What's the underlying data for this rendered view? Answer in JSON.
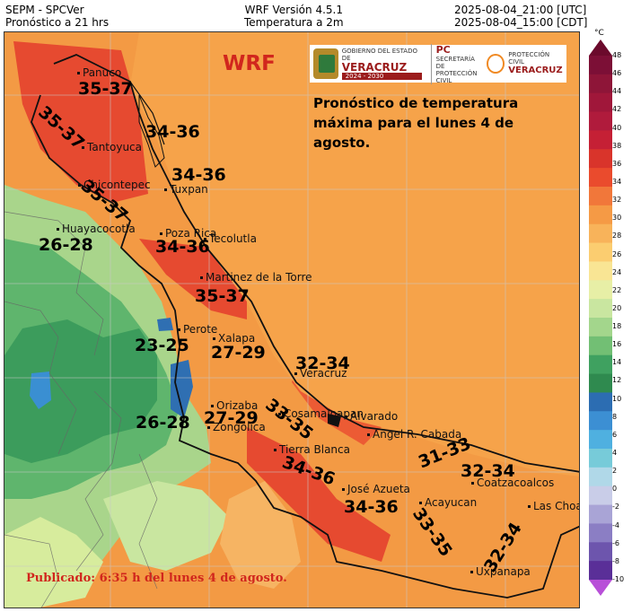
{
  "header": {
    "left_line1": "SEPM - SPCVer",
    "left_line2": "Pronóstico a 21 hrs",
    "center_line1": "WRF Versión 4.5.1",
    "center_line2": "Temperatura a 2m",
    "right_line1": "2025-08-04_21:00 [UTC]",
    "right_line2": "2025-08-04_15:00 [CDT]"
  },
  "map": {
    "model_label": "WRF",
    "forecast_title": "Pronóstico de temperatura máxima para el lunes 4 de agosto.",
    "published": "Publicado: 6:35 h del lunes 4 de agosto.",
    "logos": {
      "gov_line1": "GOBIERNO DEL ESTADO DE",
      "gov_name": "VERACRUZ",
      "gov_years": "2024 - 2030",
      "pc_name": "PC",
      "pc_sub": "SECRETARÍA DE PROTECCIÓN CIVIL",
      "pc_right_line1": "PROTECCIÓN CIVIL",
      "pc_right_line2": "VERACRUZ"
    },
    "cities": [
      {
        "name": "Panuco"
      },
      {
        "name": "Tantoyuca"
      },
      {
        "name": "Chicontepec"
      },
      {
        "name": "Tuxpan"
      },
      {
        "name": "Huayacocotla"
      },
      {
        "name": "Poza Rica"
      },
      {
        "name": "Tecolutla"
      },
      {
        "name": "Martinez de la Torre"
      },
      {
        "name": "Perote"
      },
      {
        "name": "Xalapa"
      },
      {
        "name": "Veracruz"
      },
      {
        "name": "Orizaba"
      },
      {
        "name": "Zongolica"
      },
      {
        "name": "Cosamaloapan"
      },
      {
        "name": "Alvarado"
      },
      {
        "name": "Angel R. Cabada"
      },
      {
        "name": "Tierra Blanca"
      },
      {
        "name": "José Azueta"
      },
      {
        "name": "Acayucan"
      },
      {
        "name": "Coatzacoalcos"
      },
      {
        "name": "Las Choapas"
      },
      {
        "name": "Uxpanapa"
      }
    ],
    "ranges": [
      {
        "text": "35-37"
      },
      {
        "text": "35-37"
      },
      {
        "text": "34-36"
      },
      {
        "text": "34-36"
      },
      {
        "text": "35-37"
      },
      {
        "text": "26-28"
      },
      {
        "text": "34-36"
      },
      {
        "text": "35-37"
      },
      {
        "text": "23-25"
      },
      {
        "text": "27-29"
      },
      {
        "text": "32-34"
      },
      {
        "text": "26-28"
      },
      {
        "text": "27-29"
      },
      {
        "text": "33-35"
      },
      {
        "text": "31-33"
      },
      {
        "text": "34-36"
      },
      {
        "text": "32-34"
      },
      {
        "text": "34-36"
      },
      {
        "text": "33-35"
      },
      {
        "text": "32-34"
      }
    ]
  },
  "colorbar": {
    "unit": "°C",
    "ticks": [
      "48",
      "46",
      "44",
      "42",
      "40",
      "38",
      "36",
      "34",
      "32",
      "30",
      "28",
      "26",
      "24",
      "22",
      "20",
      "18",
      "16",
      "14",
      "12",
      "10",
      "8",
      "6",
      "4",
      "2",
      "0",
      "-2",
      "-4",
      "-6",
      "-8",
      "-10"
    ],
    "colors": [
      "#6b0a2c",
      "#7c0f36",
      "#8e1538",
      "#a0173a",
      "#b01b3c",
      "#c52035",
      "#d9342b",
      "#ea4b2d",
      "#f1773a",
      "#f59a45",
      "#f8b35a",
      "#fbcd70",
      "#f9e594",
      "#e7efa6",
      "#c9e6a0",
      "#a3d68c",
      "#72bf74",
      "#3fa160",
      "#2f8a4f",
      "#2c6db2",
      "#3c8fd3",
      "#4fb0e0",
      "#77cbd9",
      "#b0d8e8",
      "#c9cde8",
      "#a9a4d6",
      "#8b7ec4",
      "#6d55ad",
      "#5a2f98",
      "#b84fd8"
    ]
  }
}
